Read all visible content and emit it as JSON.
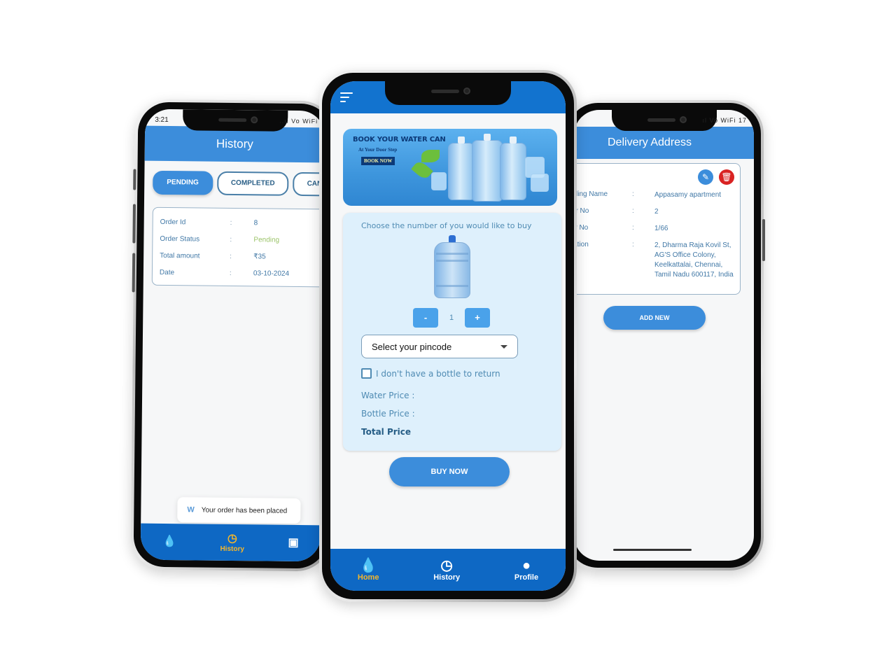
{
  "left_phone": {
    "status_time": "3:21",
    "status_icons": "..ıl Vo WiFi",
    "header_title": "History",
    "tabs": [
      {
        "label": "PENDING",
        "active": true
      },
      {
        "label": "COMPLETED",
        "active": false
      },
      {
        "label": "CANCELLED",
        "active": false
      }
    ],
    "order": {
      "rows": [
        {
          "key": "Order Id",
          "sep": ":",
          "value": "8"
        },
        {
          "key": "Order Status",
          "sep": ":",
          "value": "Pending"
        },
        {
          "key": "Total amount",
          "sep": ":",
          "value": "₹35"
        },
        {
          "key": "Date",
          "sep": ":",
          "value": "03-10-2024"
        }
      ]
    },
    "toast": {
      "logo": "W",
      "message": "Your order has been placed"
    },
    "bottom_nav": [
      {
        "icon": "water-drop-icon",
        "glyph": "💧",
        "label": "",
        "active": false
      },
      {
        "icon": "history-icon",
        "glyph": "◷",
        "label": "History",
        "active": true
      },
      {
        "icon": "wallet-icon",
        "glyph": "▣",
        "label": "",
        "active": false
      }
    ]
  },
  "center_phone": {
    "banner": {
      "title": "BOOK YOUR WATER CAN",
      "subtitle": "At Your Door Step",
      "button_label": "BOOK NOW"
    },
    "order_panel": {
      "choose_label": "Choose the number of you would like to buy",
      "quantity": "1",
      "decrement_label": "-",
      "increment_label": "+",
      "pincode_placeholder": "Select your pincode",
      "no_bottle_label": "I don't have a bottle to return",
      "no_bottle_checked": false,
      "water_price_label": "Water Price  :",
      "bottle_price_label": "Bottle Price  :",
      "total_price_label": "Total Price"
    },
    "buy_button_label": "BUY NOW",
    "bottom_nav": [
      {
        "icon": "water-drop-icon",
        "glyph": "💧",
        "label": "Home",
        "active": true
      },
      {
        "icon": "history-icon",
        "glyph": "◷",
        "label": "History",
        "active": false
      },
      {
        "icon": "profile-icon",
        "glyph": "●",
        "label": "Profile",
        "active": false
      }
    ]
  },
  "right_phone": {
    "status_icons": "ıl Vo WiFi 17",
    "header_title": "Delivery Address",
    "address": [
      {
        "key": "Building Name",
        "sep": ":",
        "value": "Appasamy apartment"
      },
      {
        "key": "Floor No",
        "sep": ":",
        "value": "2"
      },
      {
        "key": "Door No",
        "sep": ":",
        "value": "1/66"
      },
      {
        "key": "Location",
        "sep": ":",
        "value": "2, Dharma Raja Kovil St, AG'S Office Colony, Keelkattalai, Chennai, Tamil Nadu 600117, India"
      }
    ],
    "add_button_label": "ADD NEW"
  },
  "colors": {
    "primary": "#3c8ddb",
    "nav_bar": "#0e68c4",
    "active_nav": "#f5b62a",
    "pending": "#9cc46a",
    "delete": "#d92323",
    "panel": "#def0fc"
  }
}
